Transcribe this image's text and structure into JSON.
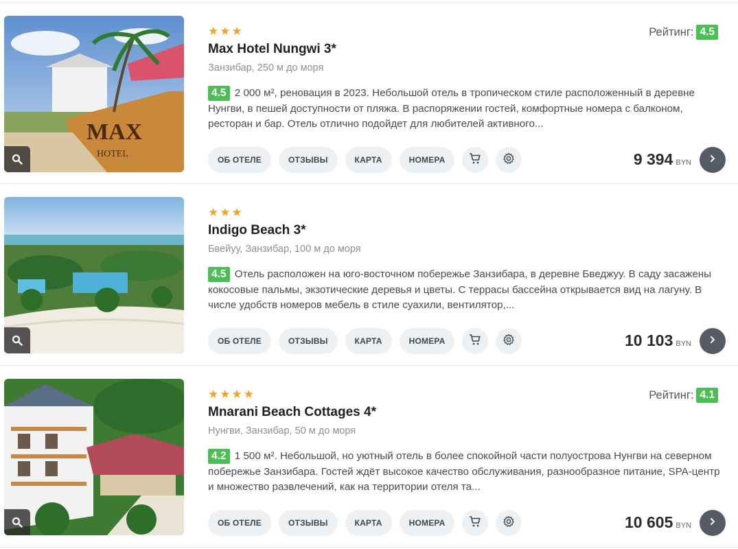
{
  "labels": {
    "rating_prefix": "Рейтинг:",
    "btn_about": "ОБ ОТЕЛЕ",
    "btn_reviews": "ОТЗЫВЫ",
    "btn_map": "КАРТА",
    "btn_rooms": "НОМЕРА",
    "currency": "BYN"
  },
  "hotels": [
    {
      "stars_text": "★★★",
      "name": "Max Hotel Nungwi 3*",
      "location": "Занзибар, 250 м до моря",
      "rating": "4.5",
      "desc_score": "4.5",
      "description": "2 000 м², реновация в 2023. Небольшой отель в тропическом стиле расположенный в деревне Нунгви, в пешей доступности от пляжа. В распоряжении гостей, комфортные номера с балконом, ресторан и бар. Отель отлично подойдет для любителей активного...",
      "price": "9 394"
    },
    {
      "stars_text": "★★★",
      "name": "Indigo Beach 3*",
      "location": "Бвейуу, Занзибар, 100 м до моря",
      "desc_score": "4.5",
      "description": "Отель расположен на юго-восточном побережье Занзибара, в деревне Бведжуу. В саду засажены кокосовые пальмы, экзотические деревья и цветы. С террасы бассейна открывается вид на лагуну. В числе удобств номеров мебель в стиле суахили, вентилятор,...",
      "price": "10 103"
    },
    {
      "stars_text": "★★★★",
      "name": "Mnarani Beach Cottages 4*",
      "location": "Нунгви, Занзибар, 50 м до моря",
      "rating": "4.1",
      "desc_score": "4.2",
      "description": "1 500 м². Небольшой, но уютный отель в более спокойной части полуострова Нунгви на северном побережье Занзибара. Гостей ждёт высокое качество обслуживания, разнообразное питание, SPA-центр и множество развлечений, как на территории отеля та...",
      "price": "10 605"
    }
  ]
}
